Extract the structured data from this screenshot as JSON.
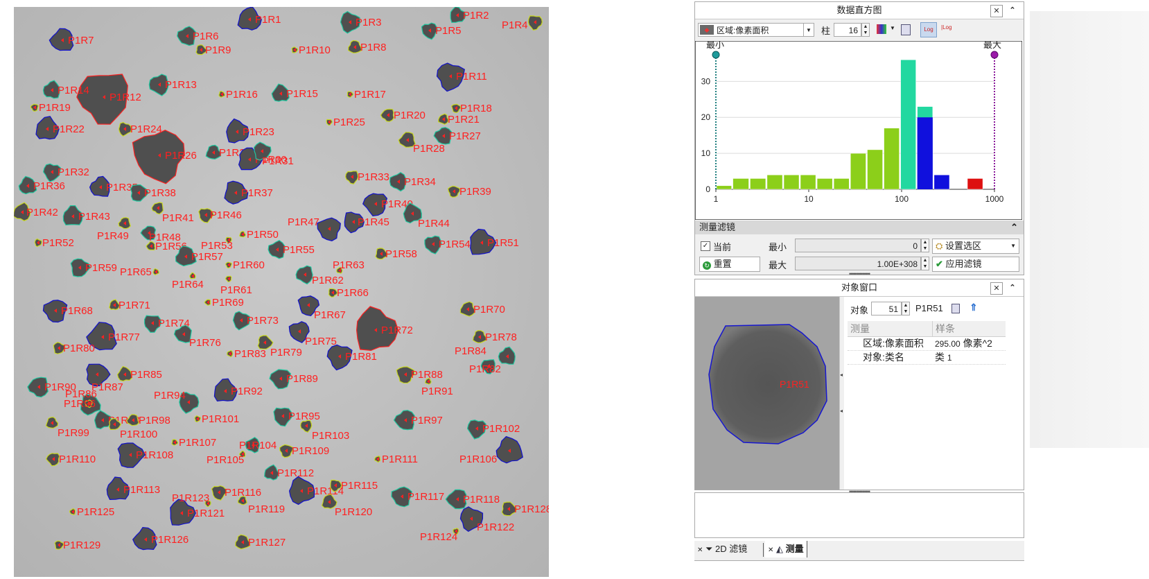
{
  "image": {
    "colonies": [
      {
        "label": "P1R1"
      },
      {
        "label": "P1R2"
      },
      {
        "label": "P1R3"
      },
      {
        "label": "P1R4"
      },
      {
        "label": "P1R5"
      },
      {
        "label": "P1R6"
      },
      {
        "label": "P1R7"
      },
      {
        "label": "P1R8"
      },
      {
        "label": "P1R9"
      },
      {
        "label": "P1R10"
      },
      {
        "label": "P1R11"
      },
      {
        "label": "P1R12"
      },
      {
        "label": "P1R13"
      },
      {
        "label": "P1R14"
      },
      {
        "label": "P1R15"
      },
      {
        "label": "P1R16"
      },
      {
        "label": "P1R17"
      },
      {
        "label": "P1R18"
      },
      {
        "label": "P1R19"
      },
      {
        "label": "P1R20"
      },
      {
        "label": "P1R21"
      },
      {
        "label": "P1R22"
      },
      {
        "label": "P1R23"
      },
      {
        "label": "P1R24"
      },
      {
        "label": "P1R25"
      },
      {
        "label": "P1R26"
      },
      {
        "label": "P1R27"
      },
      {
        "label": "P1R28"
      },
      {
        "label": "P1R29"
      },
      {
        "label": "P1R30"
      },
      {
        "label": "P1R31"
      },
      {
        "label": "P1R32"
      },
      {
        "label": "P1R33"
      },
      {
        "label": "P1R34"
      },
      {
        "label": "P1R35"
      },
      {
        "label": "P1R36"
      },
      {
        "label": "P1R37"
      },
      {
        "label": "P1R38"
      },
      {
        "label": "P1R39"
      },
      {
        "label": "P1R40"
      },
      {
        "label": "P1R41"
      },
      {
        "label": "P1R42"
      },
      {
        "label": "P1R43"
      },
      {
        "label": "P1R44"
      },
      {
        "label": "P1R45"
      },
      {
        "label": "P1R46"
      },
      {
        "label": "P1R47"
      },
      {
        "label": "P1R48"
      },
      {
        "label": "P1R49"
      },
      {
        "label": "P1R50"
      },
      {
        "label": "P1R51"
      },
      {
        "label": "P1R52"
      },
      {
        "label": "P1R53"
      },
      {
        "label": "P1R54"
      },
      {
        "label": "P1R55"
      },
      {
        "label": "P1R56"
      },
      {
        "label": "P1R57"
      },
      {
        "label": "P1R58"
      },
      {
        "label": "P1R59"
      },
      {
        "label": "P1R60"
      },
      {
        "label": "P1R61"
      },
      {
        "label": "P1R62"
      },
      {
        "label": "P1R63"
      },
      {
        "label": "P1R64"
      },
      {
        "label": "P1R65"
      },
      {
        "label": "P1R66"
      },
      {
        "label": "P1R67"
      },
      {
        "label": "P1R68"
      },
      {
        "label": "P1R69"
      },
      {
        "label": "P1R70"
      },
      {
        "label": "P1R71"
      },
      {
        "label": "P1R72"
      },
      {
        "label": "P1R73"
      },
      {
        "label": "P1R74"
      },
      {
        "label": "P1R75"
      },
      {
        "label": "P1R76"
      },
      {
        "label": "P1R77"
      },
      {
        "label": "P1R78"
      },
      {
        "label": "P1R79"
      },
      {
        "label": "P1R80"
      },
      {
        "label": "P1R81"
      },
      {
        "label": "P1R82"
      },
      {
        "label": "P1R83"
      },
      {
        "label": "P1R84"
      },
      {
        "label": "P1R85"
      },
      {
        "label": "P1R86"
      },
      {
        "label": "P1R87"
      },
      {
        "label": "P1R88"
      },
      {
        "label": "P1R89"
      },
      {
        "label": "P1R90"
      },
      {
        "label": "P1R91"
      },
      {
        "label": "P1R92"
      },
      {
        "label": "P1R93"
      },
      {
        "label": "P1R94"
      },
      {
        "label": "P1R95"
      },
      {
        "label": "P1R96"
      },
      {
        "label": "P1R97"
      },
      {
        "label": "P1R98"
      },
      {
        "label": "P1R99"
      },
      {
        "label": "P1R100"
      },
      {
        "label": "P1R101"
      },
      {
        "label": "P1R102"
      },
      {
        "label": "P1R103"
      },
      {
        "label": "P1R104"
      },
      {
        "label": "P1R105"
      },
      {
        "label": "P1R106"
      },
      {
        "label": "P1R107"
      },
      {
        "label": "P1R108"
      },
      {
        "label": "P1R109"
      },
      {
        "label": "P1R110"
      },
      {
        "label": "P1R111"
      },
      {
        "label": "P1R112"
      },
      {
        "label": "P1R113"
      },
      {
        "label": "P1R114"
      },
      {
        "label": "P1R115"
      },
      {
        "label": "P1R116"
      },
      {
        "label": "P1R117"
      },
      {
        "label": "P1R118"
      },
      {
        "label": "P1R119"
      },
      {
        "label": "P1R120"
      },
      {
        "label": "P1R121"
      },
      {
        "label": "P1R122"
      },
      {
        "label": "P1R123"
      },
      {
        "label": "P1R124"
      },
      {
        "label": "P1R125"
      },
      {
        "label": "P1R126"
      },
      {
        "label": "P1R127"
      },
      {
        "label": "P1R128"
      },
      {
        "label": "P1R129"
      }
    ],
    "colors": {
      "large": "#ff2020",
      "medium": "#1010cc",
      "small": "#20c8a0",
      "tiny": "#c8d820",
      "label": "#ff2020"
    }
  },
  "histogram": {
    "title": "数据直方图",
    "measure_select": "区域:像素面积",
    "bins_label": "柱",
    "bins_value": "16",
    "min_label": "最小",
    "max_label": "最大",
    "y_ticks": [
      "0",
      "10",
      "20",
      "30"
    ],
    "x_ticks": [
      "1",
      "10",
      "100",
      "1000"
    ]
  },
  "chart_data": {
    "type": "bar",
    "title": "",
    "xlabel": "",
    "ylabel": "",
    "x_scale": "log",
    "xlim": [
      1,
      1000
    ],
    "ylim": [
      0,
      37
    ],
    "bars": [
      {
        "x0": 1,
        "x1": 1.5,
        "value": 1,
        "color": "#8ccf1a"
      },
      {
        "x0": 1.5,
        "x1": 2.3,
        "value": 3,
        "color": "#8ccf1a"
      },
      {
        "x0": 2.3,
        "x1": 3.5,
        "value": 3,
        "color": "#8ccf1a"
      },
      {
        "x0": 3.5,
        "x1": 5.3,
        "value": 4,
        "color": "#8ccf1a"
      },
      {
        "x0": 5.3,
        "x1": 8,
        "value": 4,
        "color": "#8ccf1a"
      },
      {
        "x0": 8,
        "x1": 12.1,
        "value": 4,
        "color": "#8ccf1a"
      },
      {
        "x0": 12.1,
        "x1": 18.3,
        "value": 3,
        "color": "#8ccf1a"
      },
      {
        "x0": 18.3,
        "x1": 27.7,
        "value": 3,
        "color": "#8ccf1a"
      },
      {
        "x0": 27.7,
        "x1": 42,
        "value": 10,
        "color": "#8ccf1a"
      },
      {
        "x0": 42,
        "x1": 63.5,
        "value": 11,
        "color": "#8ccf1a"
      },
      {
        "x0": 63.5,
        "x1": 96,
        "value": 17,
        "color": "#8ccf1a"
      },
      {
        "x0": 96,
        "x1": 145,
        "value": 36,
        "color": "#22d8a0"
      },
      {
        "x0": 145,
        "x1": 220,
        "value": 23,
        "color": "#22d8a0",
        "lower_value": 20,
        "lower_color": "#1010dd"
      },
      {
        "x0": 220,
        "x1": 333,
        "value": 4,
        "color": "#1010dd"
      },
      {
        "x0": 503,
        "x1": 761,
        "value": 3,
        "color": "#dd1010"
      }
    ],
    "thresholds": {
      "min": 1,
      "max": 1000
    }
  },
  "filter": {
    "title": "测量滤镜",
    "current_label": "当前",
    "current_checked": true,
    "reset_label": "重置",
    "min_label": "最小",
    "min_value": "0",
    "max_label": "最大",
    "max_value": "1.00E+308",
    "select_label": "设置选区",
    "apply_label": "应用滤镜"
  },
  "object_window": {
    "title": "对象窗口",
    "object_label": "对象",
    "object_number": "51",
    "object_name": "P1R51",
    "preview_label": "P1R51",
    "col_measure": "测量",
    "col_bar": "样条",
    "rows": [
      {
        "measure": "区域:像素面积",
        "value_small": "295.00",
        "value_unit": "像素^2"
      },
      {
        "measure": "对象:类名",
        "value_prefix": "类",
        "value_small": "1"
      }
    ]
  },
  "tabs": [
    {
      "label": "2D 滤镜"
    },
    {
      "label": "测量"
    }
  ]
}
